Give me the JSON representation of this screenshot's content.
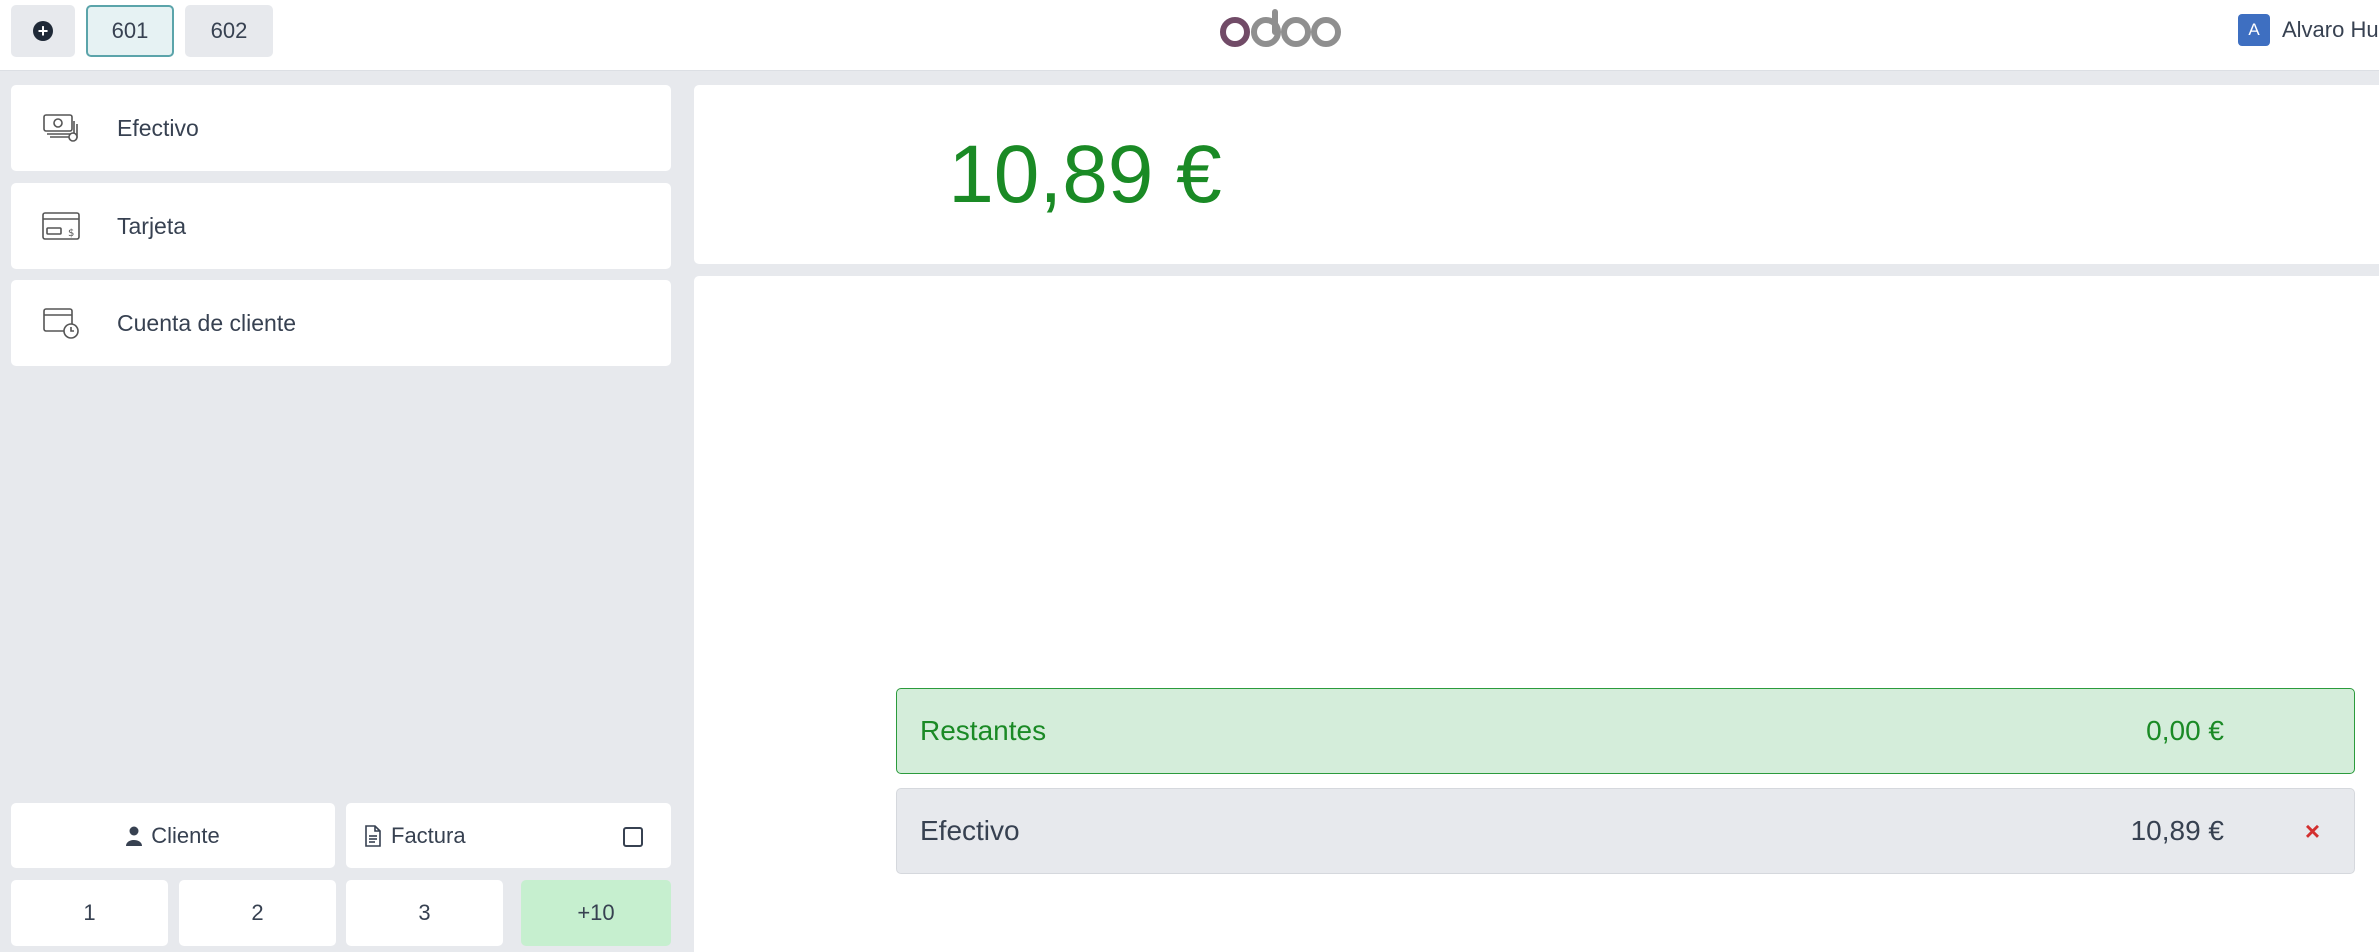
{
  "topbar": {
    "tabs": [
      "601",
      "602"
    ],
    "logo_text": "odoo",
    "user": {
      "initial": "A",
      "name": "Alvaro Hu"
    }
  },
  "payment_methods": [
    {
      "label": "Efectivo",
      "icon": "cash-icon"
    },
    {
      "label": "Tarjeta",
      "icon": "card-icon"
    },
    {
      "label": "Cuenta de cliente",
      "icon": "customer-account-icon"
    }
  ],
  "actions": {
    "customer_label": "Cliente",
    "invoice_label": "Factura",
    "invoice_checked": false
  },
  "numpad": [
    "1",
    "2",
    "3",
    "+10"
  ],
  "total": "10,89 €",
  "lines": {
    "remaining": {
      "label": "Restantes",
      "amount": "0,00 €"
    },
    "cash": {
      "label": "Efectivo",
      "amount": "10,89 €",
      "delete_symbol": "×"
    }
  },
  "colors": {
    "accent_green": "#1a8a25",
    "remaining_bg": "#d4edda",
    "numpad_highlight": "#c6efcf",
    "delete_red": "#d32f2f",
    "avatar_blue": "#3e6fc1"
  }
}
